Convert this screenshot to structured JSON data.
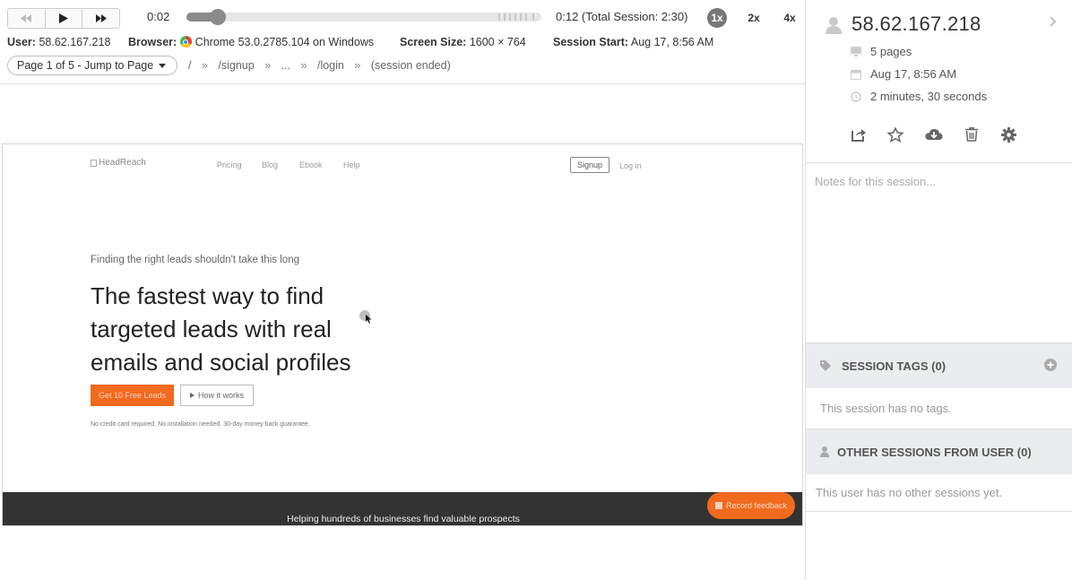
{
  "player": {
    "current_time": "0:02",
    "progress_fraction": 0.07,
    "time_total": "0:12 (Total Session: 2:30)",
    "speeds": [
      {
        "label": "1x",
        "active": true
      },
      {
        "label": "2x",
        "active": false
      },
      {
        "label": "4x",
        "active": false
      }
    ]
  },
  "meta": {
    "user_label": "User:",
    "user_value": "58.62.167.218",
    "browser_label": "Browser:",
    "browser_value": "Chrome 53.0.2785.104 on Windows",
    "screen_label": "Screen Size:",
    "screen_value": "1600 × 764",
    "start_label": "Session Start:",
    "start_value": "Aug 17, 8:56 AM"
  },
  "nav": {
    "page_select": "Page 1 of 5 - Jump to Page",
    "crumbs": [
      "/",
      "»",
      "/signup",
      "»",
      "...",
      "»",
      "/login",
      "»",
      "(session ended)"
    ]
  },
  "site": {
    "logo_alt": "HeadReach",
    "nav_items": [
      "Pricing",
      "Blog",
      "Ebook",
      "Help"
    ],
    "signup": "Signup",
    "login": "Log in",
    "kicker": "Finding the right leads shouldn't take this long",
    "headline": [
      "The fastest way to find",
      "targeted leads with real",
      "emails and social profiles"
    ],
    "cta": "Get 10 Free Leads",
    "how": "How it works",
    "fine_print": "No credit card required. No installation needed. 30-day money back guarantee.",
    "footer": "Helping hundreds of businesses find valuable prospects",
    "feedback": "Record feedback"
  },
  "sidebar": {
    "ip": "58.62.167.218",
    "pages": "5 pages",
    "date": "Aug 17, 8:56 AM",
    "duration": "2 minutes, 30 seconds",
    "notes_placeholder": "Notes for this session...",
    "tags_header": "SESSION TAGS (0)",
    "tags_empty": "This session has no tags.",
    "other_header": "OTHER SESSIONS FROM USER (0)",
    "other_empty": "This user has no other sessions yet."
  },
  "colors": {
    "accent_orange": "#f06a1f",
    "footer_dark": "#333333",
    "section_bg": "#eaecef"
  }
}
